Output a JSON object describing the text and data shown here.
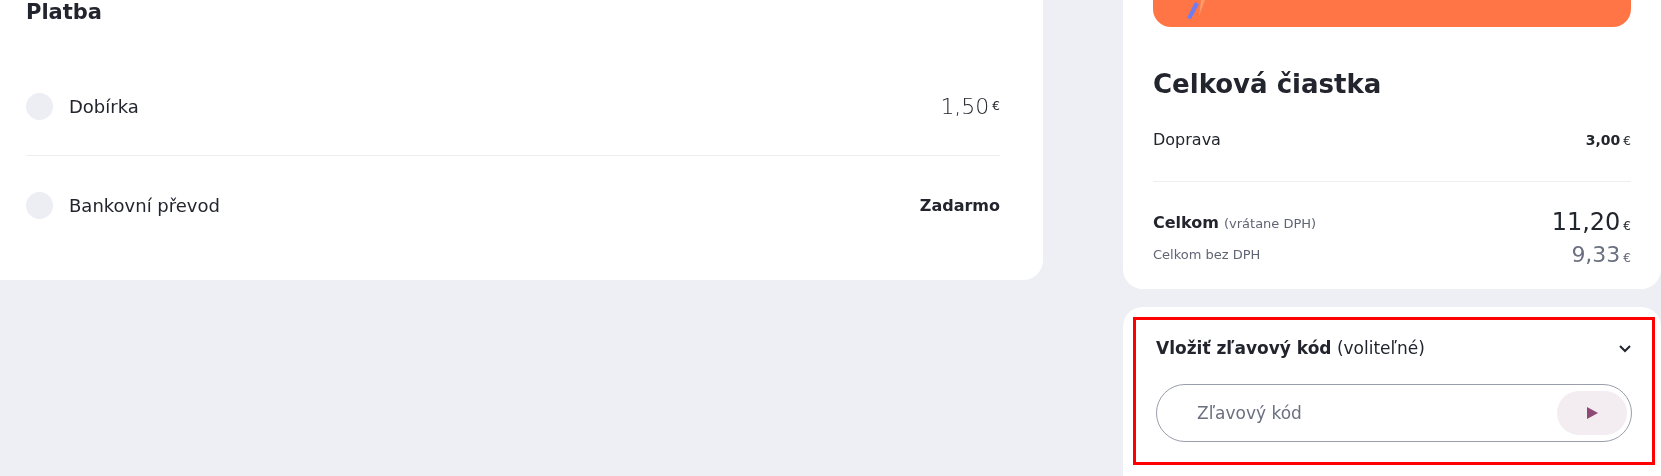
{
  "payment": {
    "title": "Platba",
    "options": [
      {
        "label": "Dobírka",
        "kind": "paid",
        "price": "1,50",
        "currency": "€",
        "selected": false
      },
      {
        "label": "Bankovní převod",
        "kind": "free",
        "price": "Zadarmo",
        "selected": false
      }
    ]
  },
  "summary": {
    "title": "Celková čiastka",
    "shipping": {
      "label": "Doprava",
      "price": "3,00",
      "currency": "€"
    },
    "total": {
      "label": "Celkom",
      "note": "(vrátane DPH)",
      "price": "11,20",
      "currency": "€"
    },
    "net": {
      "label": "Celkom bez DPH",
      "price": "9,33",
      "currency": "€"
    }
  },
  "discount": {
    "title": "Vložiť zľavový kód",
    "note": "(voliteľné)",
    "expanded": true,
    "placeholder": "Zľavový kód"
  }
}
